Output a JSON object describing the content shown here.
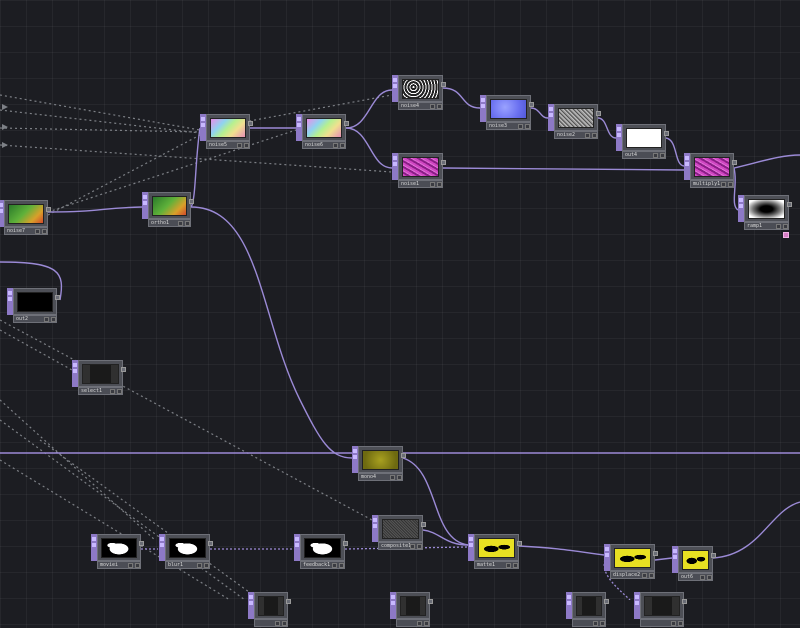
{
  "app": "TouchDesigner network editor",
  "nodes": [
    {
      "id": "noise4",
      "label": "noise4",
      "thumb": "bw-noise-dense"
    },
    {
      "id": "noise3",
      "label": "noise3",
      "thumb": "blue-noise"
    },
    {
      "id": "noise2",
      "label": "noise2",
      "thumb": "gray-noise"
    },
    {
      "id": "out4",
      "label": "out4",
      "thumb": "white"
    },
    {
      "id": "noise1",
      "label": "noise1",
      "thumb": "magenta-noise"
    },
    {
      "id": "multiply1",
      "label": "multiply1",
      "thumb": "magenta-noise"
    },
    {
      "id": "ramp1",
      "label": "ramp1",
      "thumb": "radial-ramp"
    },
    {
      "id": "noise5",
      "label": "noise5",
      "thumb": "rainbow"
    },
    {
      "id": "noise6",
      "label": "noise6",
      "thumb": "rainbow"
    },
    {
      "id": "noise7",
      "label": "noise7",
      "thumb": "green-ramp"
    },
    {
      "id": "ortho1",
      "label": "ortho1",
      "thumb": "green-ramp"
    },
    {
      "id": "out2",
      "label": "out2",
      "thumb": "black"
    },
    {
      "id": "select1",
      "label": "select1",
      "thumb": "dark-gray"
    },
    {
      "id": "mono4",
      "label": "mono4",
      "thumb": "olive"
    },
    {
      "id": "compsite1",
      "label": "composite1",
      "thumb": "gray-noise-dark"
    },
    {
      "id": "mask1",
      "label": "matte1",
      "thumb": "yellow-shape"
    },
    {
      "id": "displace2",
      "label": "displace2",
      "thumb": "yellow-shape"
    },
    {
      "id": "out6",
      "label": "out6",
      "thumb": "yellow-shape"
    },
    {
      "id": "moviein1",
      "label": "moviei",
      "thumb": "bw-blob"
    },
    {
      "id": "blur1",
      "label": "blur1",
      "thumb": "bw-blob"
    },
    {
      "id": "feedback1",
      "label": "feedback1",
      "thumb": "bw-blob"
    },
    {
      "id": "bot1",
      "label": "",
      "thumb": "dark-gray"
    },
    {
      "id": "bot2",
      "label": "",
      "thumb": "dark-gray"
    },
    {
      "id": "bot3",
      "label": "",
      "thumb": "dark-gray"
    },
    {
      "id": "bot4",
      "label": "",
      "thumb": "dark-gray"
    }
  ],
  "colors": {
    "background": "#1c1d22",
    "wire": "#9b8ad6",
    "dotted_link": "#7d8086",
    "operator_side": "#8d79c6",
    "node_body": "#4d4f56"
  }
}
